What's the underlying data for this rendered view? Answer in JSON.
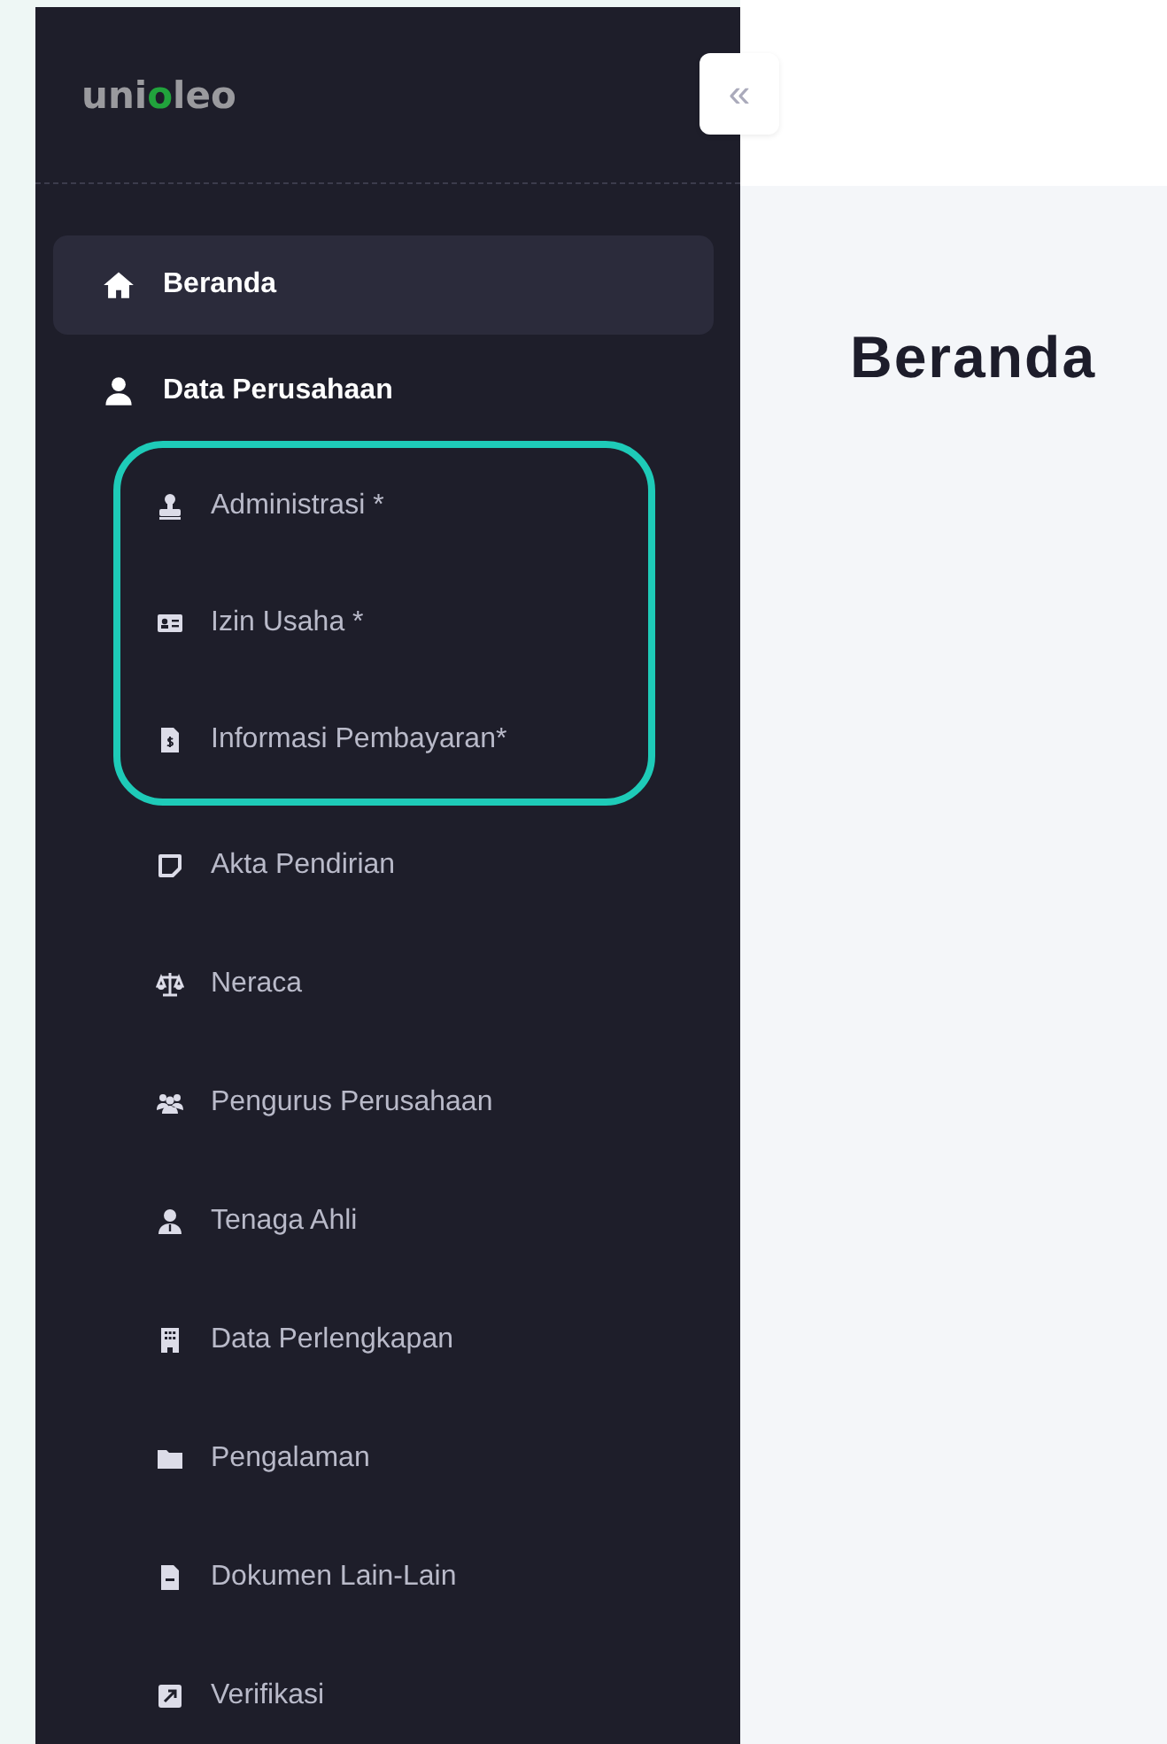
{
  "logo": {
    "parts": [
      {
        "text": "uni",
        "accent": false
      },
      {
        "text": "o",
        "accent": true
      },
      {
        "text": "leo",
        "accent": false
      }
    ]
  },
  "collapse_button": {
    "label": "«"
  },
  "menu": [
    {
      "label": "Beranda",
      "selected": true
    },
    {
      "label": "Data Perusahaan",
      "selected": false
    }
  ],
  "submenu_groups": [
    {
      "highlighted": true,
      "items": [
        {
          "label": "Administrasi *"
        },
        {
          "label": "Izin Usaha *"
        },
        {
          "label": "Informasi Pembayaran*"
        }
      ]
    },
    {
      "highlighted": false,
      "items": [
        {
          "label": "Akta Pendirian"
        },
        {
          "label": "Neraca"
        },
        {
          "label": "Pengurus Perusahaan"
        },
        {
          "label": "Tenaga Ahli"
        },
        {
          "label": "Data Perlengkapan"
        },
        {
          "label": "Pengalaman"
        },
        {
          "label": "Dokumen Lain-Lain"
        },
        {
          "label": "Verifikasi"
        }
      ]
    }
  ],
  "page_title": "Beranda"
}
